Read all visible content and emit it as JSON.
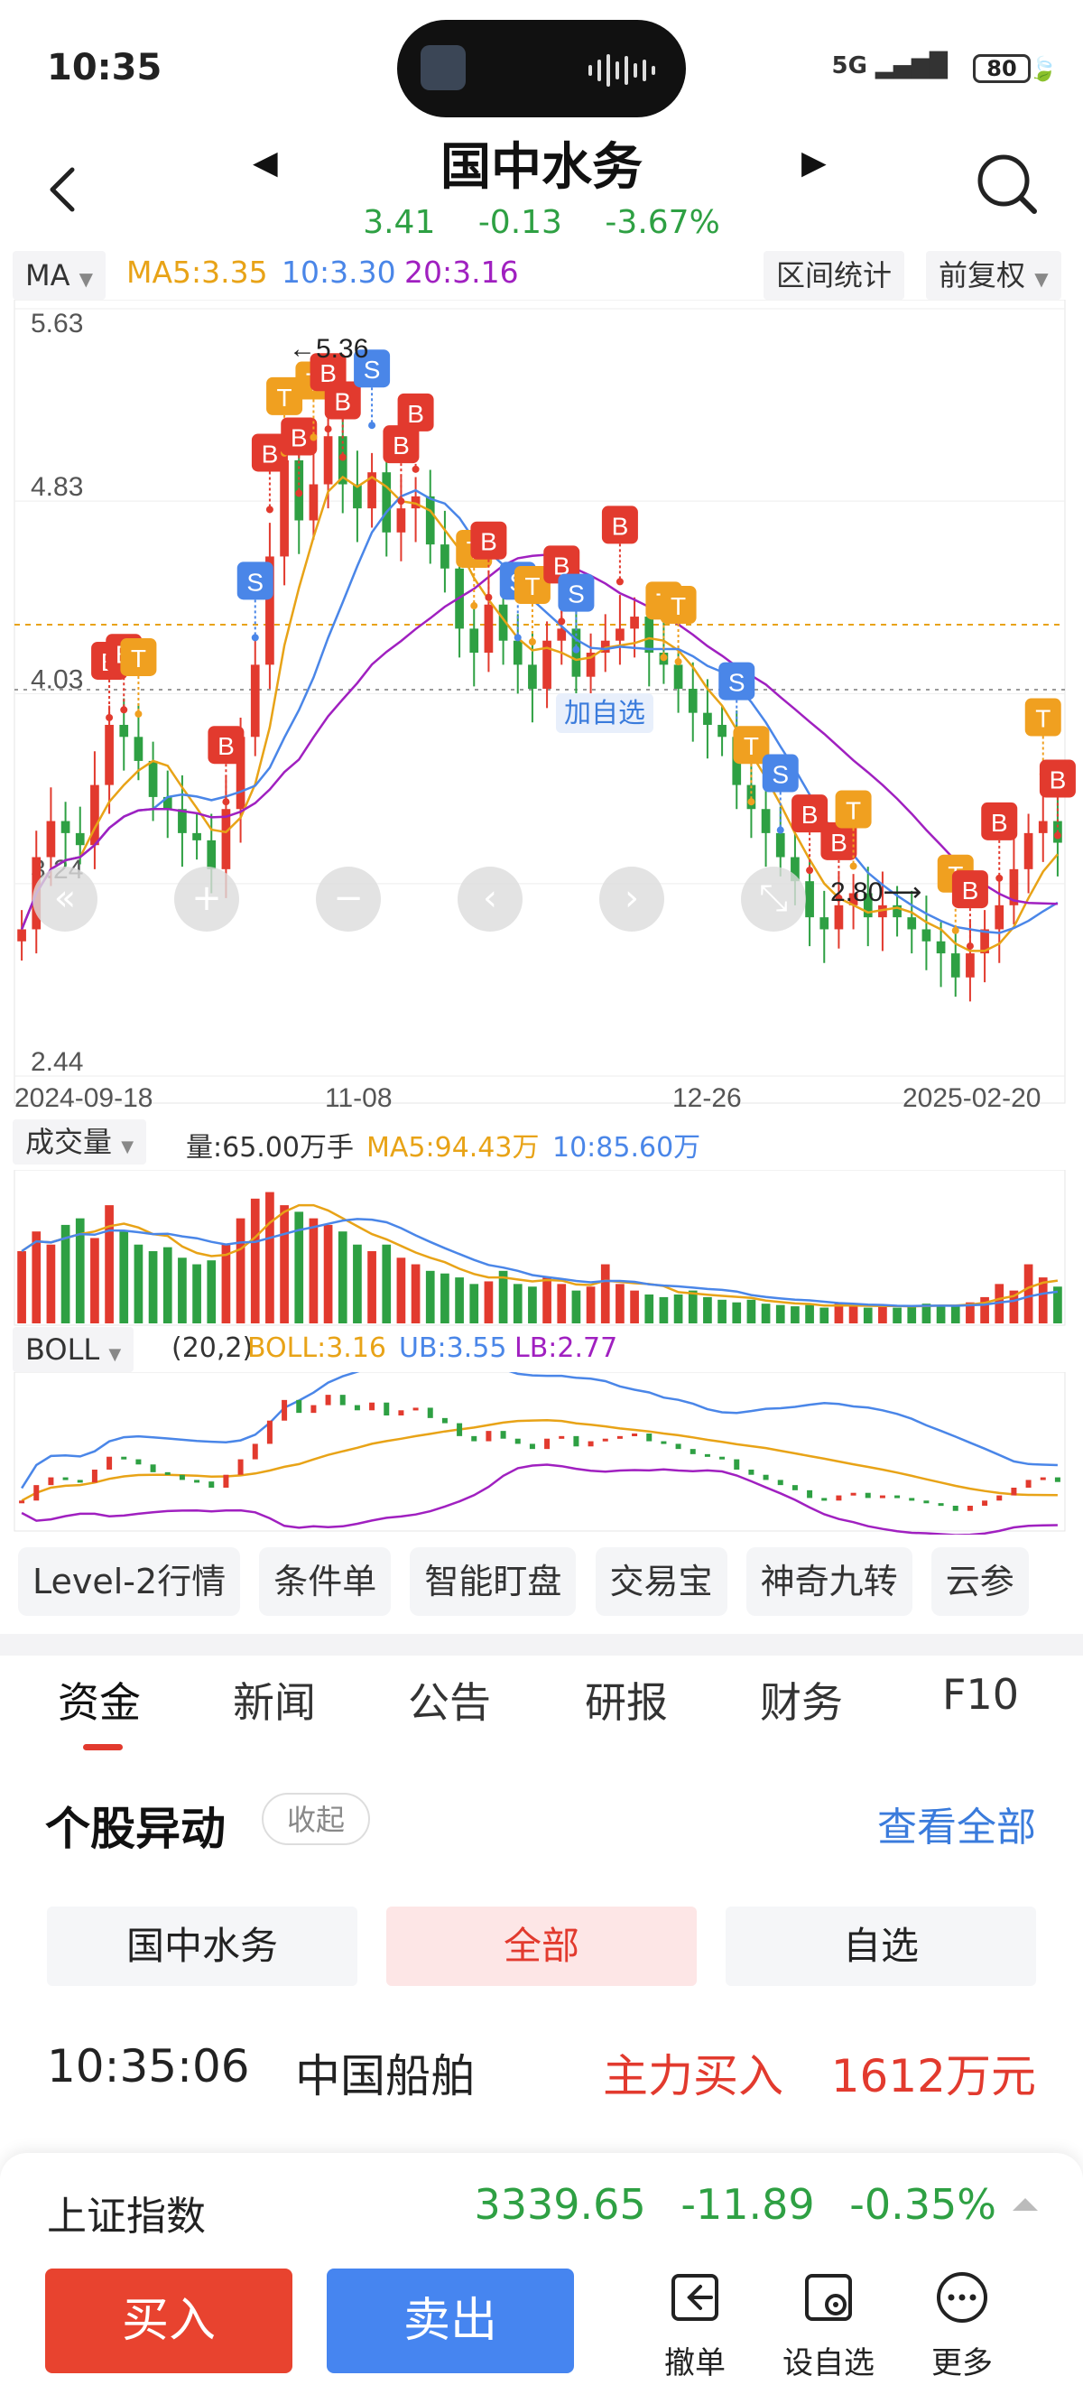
{
  "status": {
    "time": "10:35",
    "network": "5G",
    "battery": "80"
  },
  "header": {
    "title": "国中水务",
    "price": "3.41",
    "change": "-0.13",
    "change_pct": "-3.67%"
  },
  "ma_bar": {
    "indicator": "MA",
    "ma5": "MA5:3.35",
    "ma10": "10:3.30",
    "ma20": "20:3.16",
    "range_stats": "区间统计",
    "adjust": "前复权"
  },
  "chart_data": [
    {
      "type": "candlestick",
      "y_ticks": [
        "5.63",
        "4.83",
        "4.03",
        "3.24",
        "2.44"
      ],
      "x_ticks": [
        "2024-09-18",
        "11-08",
        "12-26",
        "2025-02-20"
      ],
      "ylim": [
        2.44,
        5.63
      ],
      "high_marker": "←5.36",
      "low_marker": "2.80⟶",
      "series": [
        {
          "name": "MA5",
          "color": "#e8a317"
        },
        {
          "name": "MA10",
          "color": "#4a86e8"
        },
        {
          "name": "MA20",
          "color": "#a020c0"
        }
      ],
      "close": [
        3.05,
        3.35,
        3.5,
        3.45,
        3.4,
        3.65,
        3.9,
        3.85,
        3.75,
        3.6,
        3.55,
        3.45,
        3.42,
        3.3,
        3.55,
        3.85,
        4.15,
        4.6,
        5.0,
        4.75,
        4.9,
        5.1,
        4.9,
        4.8,
        4.95,
        4.7,
        4.8,
        4.85,
        4.65,
        4.55,
        4.3,
        4.2,
        4.4,
        4.25,
        4.15,
        4.05,
        4.25,
        4.3,
        4.1,
        4.2,
        4.25,
        4.3,
        4.35,
        4.2,
        4.15,
        4.05,
        3.95,
        3.9,
        3.85,
        3.65,
        3.55,
        3.45,
        3.35,
        3.25,
        3.1,
        3.05,
        3.15,
        3.2,
        3.1,
        3.15,
        3.1,
        3.05,
        3.0,
        2.95,
        2.85,
        2.95,
        3.05,
        3.15,
        3.3,
        3.45,
        3.5,
        3.41
      ]
    },
    {
      "type": "bar",
      "label": "成交量",
      "volume_text": "量:65.00万手",
      "ma5_text": "MA5:94.43万",
      "ma10_text": "10:85.60万",
      "values": [
        55,
        70,
        60,
        75,
        80,
        65,
        90,
        70,
        60,
        55,
        58,
        50,
        45,
        48,
        60,
        80,
        95,
        100,
        90,
        85,
        80,
        75,
        70,
        60,
        55,
        60,
        50,
        45,
        40,
        38,
        35,
        30,
        32,
        40,
        30,
        28,
        35,
        30,
        25,
        28,
        45,
        30,
        25,
        22,
        20,
        22,
        25,
        20,
        18,
        16,
        18,
        15,
        14,
        13,
        14,
        12,
        15,
        14,
        12,
        13,
        12,
        14,
        15,
        14,
        13,
        16,
        20,
        30,
        25,
        45,
        35,
        28
      ]
    },
    {
      "type": "line",
      "label": "BOLL",
      "params": "(20,2)",
      "boll_text": "BOLL:3.16",
      "ub_text": "UB:3.55",
      "lb_text": "LB:2.77"
    }
  ],
  "markers": {
    "b": "B",
    "s": "S",
    "t": "T",
    "add_watch": "加自选"
  },
  "tools": [
    "Level-2行情",
    "条件单",
    "智能盯盘",
    "交易宝",
    "神奇九转",
    "云参"
  ],
  "tabs": [
    "资金",
    "新闻",
    "公告",
    "研报",
    "财务",
    "F10"
  ],
  "section": {
    "title": "个股异动",
    "collapse": "收起",
    "view_all": "查看全部"
  },
  "filters": [
    "国中水务",
    "全部",
    "自选"
  ],
  "event": {
    "time": "10:35:06",
    "name": "中国船舶",
    "action": "主力买入",
    "amount": "1612万元"
  },
  "index_bar": {
    "name": "上证指数",
    "value": "3339.65",
    "change": "-11.89",
    "pct": "-0.35%"
  },
  "actions": {
    "buy": "买入",
    "sell": "卖出",
    "cancel": "撤单",
    "set_watch": "设自选",
    "more": "更多"
  }
}
